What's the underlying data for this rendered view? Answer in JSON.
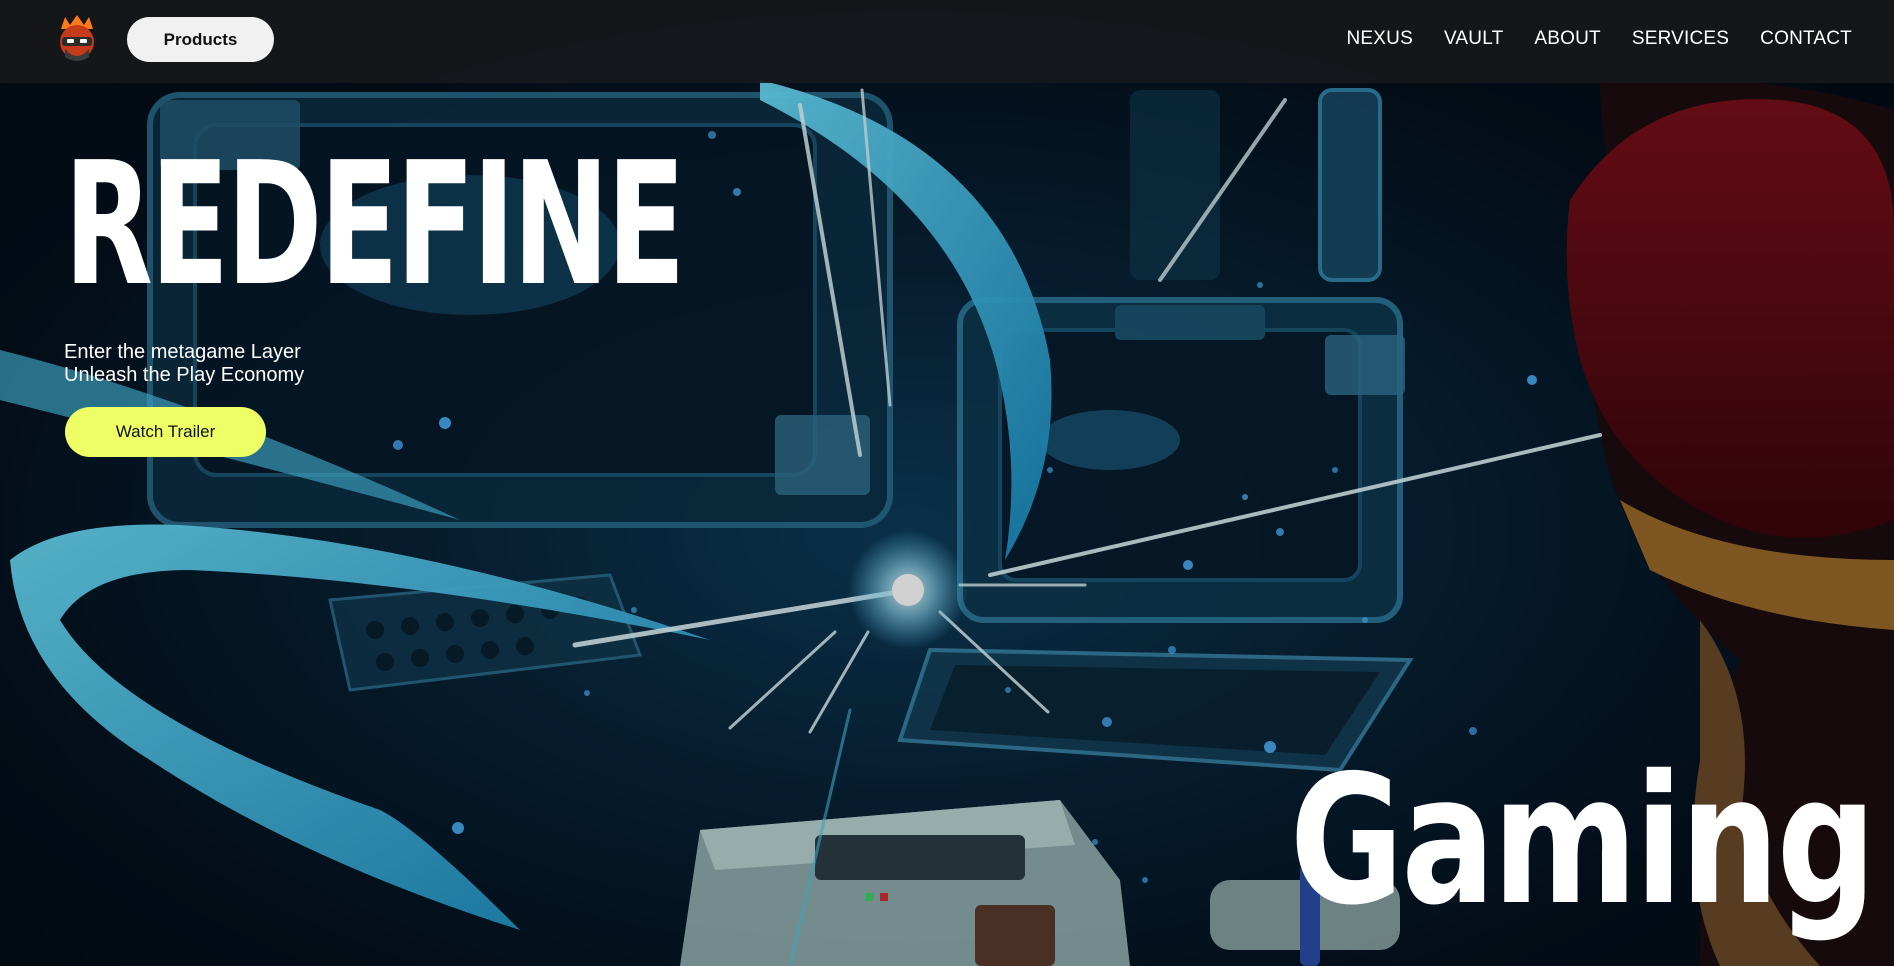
{
  "navbar": {
    "logo_icon": "ninja-mascot-icon",
    "products_label": "Products",
    "links": [
      "NEXUS",
      "VAULT",
      "ABOUT",
      "SERVICES",
      "CONTACT"
    ]
  },
  "hero": {
    "title": "REDEFINE",
    "subtitle_line1": "Enter the metagame Layer",
    "subtitle_line2": "Unleash the Play Economy",
    "cta_label": "Watch Trailer",
    "bottom_word": "Gaming",
    "background_icon": "retro-gaming-room-illustration"
  },
  "colors": {
    "navbar_bg": "#16181b",
    "cta_bg": "#eeff66",
    "products_bg": "#f1f1f1",
    "text": "#ffffff",
    "glow": "#5fd3ff"
  }
}
